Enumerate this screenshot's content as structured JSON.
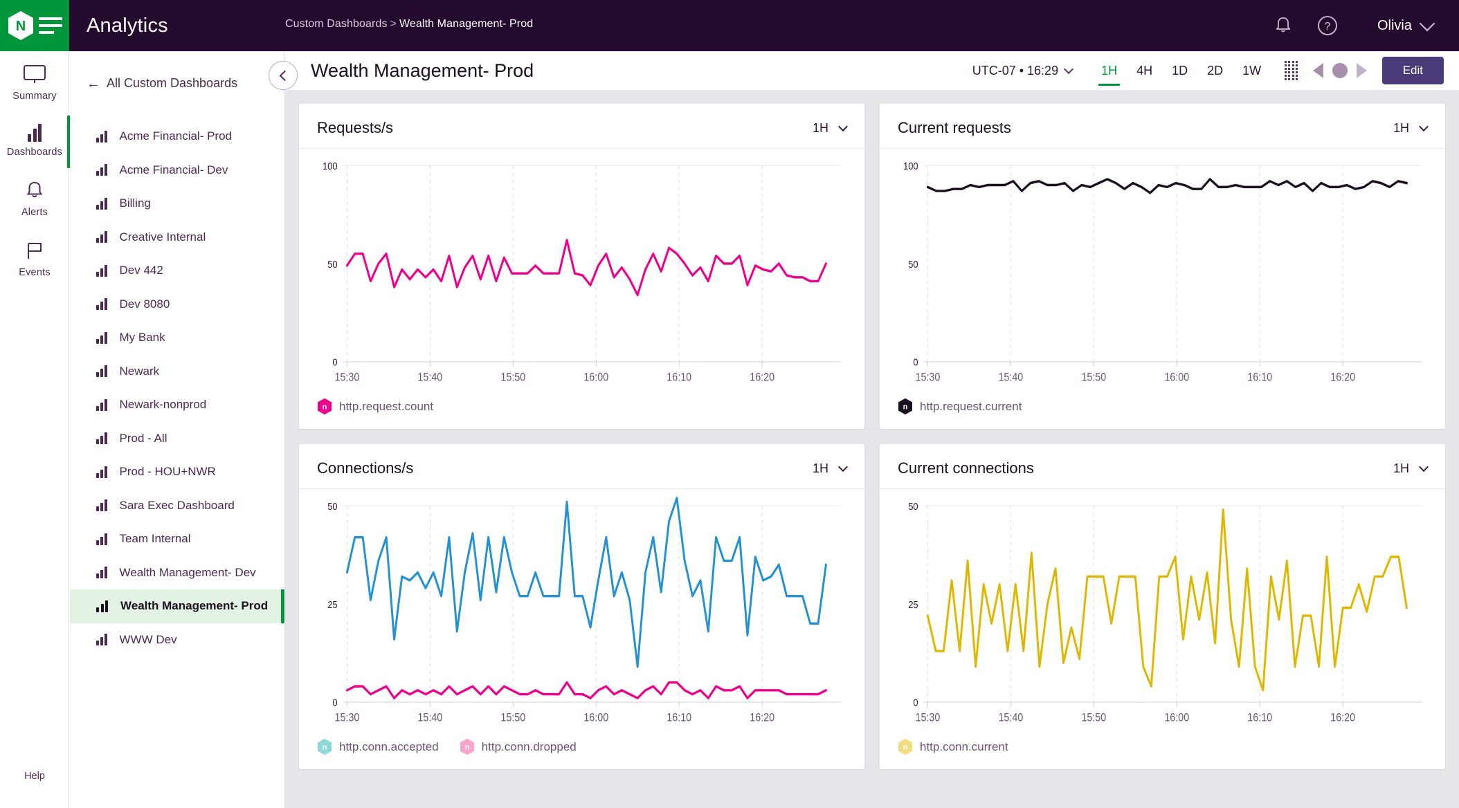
{
  "header": {
    "logo_icon": "nginx-logo-icon",
    "menu_icon": "hamburger-icon",
    "app_title": "Analytics",
    "breadcrumb_parent": "Custom Dashboards",
    "breadcrumb_separator": ">",
    "breadcrumb_current": "Wealth Management- Prod",
    "bell_icon": "notification-bell-icon",
    "help_icon": "help-circle-icon",
    "user_name": "Olivia",
    "bg_color": "#240a2e",
    "logo_bg_color": "#009639"
  },
  "rail": {
    "items": [
      {
        "label": "Summary",
        "icon": "monitor-icon",
        "active": false
      },
      {
        "label": "Dashboards",
        "icon": "bar-chart-icon",
        "active": true
      },
      {
        "label": "Alerts",
        "icon": "bell-icon",
        "active": false
      },
      {
        "label": "Events",
        "icon": "flag-icon",
        "active": false
      }
    ],
    "help_label": "Help",
    "active_color": "#009639"
  },
  "list_pane": {
    "back_label": "All Custom Dashboards",
    "back_icon": "arrow-left-icon",
    "items": [
      {
        "label": "Acme Financial- Prod",
        "active": false
      },
      {
        "label": "Acme Financial- Dev",
        "active": false
      },
      {
        "label": "Billing",
        "active": false
      },
      {
        "label": "Creative Internal",
        "active": false
      },
      {
        "label": "Dev 442",
        "active": false
      },
      {
        "label": "Dev 8080",
        "active": false
      },
      {
        "label": "My Bank",
        "active": false
      },
      {
        "label": "Newark",
        "active": false
      },
      {
        "label": "Newark-nonprod",
        "active": false
      },
      {
        "label": "Prod - All",
        "active": false
      },
      {
        "label": "Prod - HOU+NWR",
        "active": false
      },
      {
        "label": "Sara Exec Dashboard",
        "active": false
      },
      {
        "label": "Team Internal",
        "active": false
      },
      {
        "label": "Wealth Management- Dev",
        "active": false
      },
      {
        "label": "Wealth Management- Prod",
        "active": true
      },
      {
        "label": "WWW Dev",
        "active": false
      }
    ],
    "active_bg": "#e2f3e4"
  },
  "dashboard": {
    "collapse_icon": "chevron-left-circle-icon",
    "title": "Wealth Management- Prod",
    "timezone_label": "UTC-07 • 16:29",
    "timezone_chevron_icon": "chevron-down-icon",
    "ranges": [
      {
        "label": "1H",
        "active": true
      },
      {
        "label": "4H",
        "active": false
      },
      {
        "label": "1D",
        "active": false
      },
      {
        "label": "2D",
        "active": false
      },
      {
        "label": "1W",
        "active": false
      }
    ],
    "grid_icon": "grid-dots-icon",
    "prev_icon": "play-back-icon",
    "pause_icon": "pause-dot-icon",
    "next_icon": "play-forward-icon",
    "edit_label": "Edit",
    "edit_color": "#4a3a7a",
    "active_range_color": "#009639"
  },
  "chart_data": [
    {
      "type": "line",
      "title": "Requests/s",
      "range_label": "1H",
      "range_chevron_icon": "chevron-down-icon",
      "xlabel": "",
      "ylabel": "",
      "ylim": [
        0,
        100
      ],
      "yticks": [
        0,
        50,
        100
      ],
      "xticks": [
        "15:30",
        "15:40",
        "15:50",
        "16:00",
        "16:10",
        "16:20"
      ],
      "grid": "vertical-dotted",
      "legend_position": "bottom-left",
      "series": [
        {
          "name": "http.request.count",
          "color": "#ec008c",
          "legend_icon": "nginx-hex-icon",
          "values": [
            49,
            55,
            55,
            41,
            50,
            55,
            38,
            47,
            42,
            47,
            43,
            47,
            41,
            54,
            38,
            48,
            54,
            42,
            54,
            41,
            53,
            45,
            45,
            45,
            49,
            45,
            45,
            45,
            62,
            45,
            44,
            39,
            49,
            55,
            43,
            48,
            42,
            34,
            47,
            55,
            46,
            58,
            55,
            50,
            44,
            48,
            41,
            54,
            50,
            50,
            54,
            39,
            49,
            47,
            46,
            50,
            44,
            43,
            43,
            41,
            41,
            50
          ]
        }
      ]
    },
    {
      "type": "line",
      "title": "Current requests",
      "range_label": "1H",
      "range_chevron_icon": "chevron-down-icon",
      "xlabel": "",
      "ylabel": "",
      "ylim": [
        0,
        100
      ],
      "yticks": [
        0,
        50,
        100
      ],
      "xticks": [
        "15:30",
        "15:40",
        "15:50",
        "16:00",
        "16:10",
        "16:20"
      ],
      "grid": "vertical-dotted",
      "legend_position": "bottom-left",
      "series": [
        {
          "name": "http.request.current",
          "color": "#1c1020",
          "legend_icon": "nginx-hex-icon",
          "values": [
            89,
            87,
            87,
            88,
            88,
            90,
            89,
            90,
            90,
            90,
            92,
            87,
            91,
            92,
            90,
            90,
            91,
            87,
            90,
            89,
            91,
            93,
            91,
            88,
            91,
            89,
            86,
            90,
            89,
            91,
            90,
            88,
            88,
            93,
            89,
            89,
            90,
            89,
            89,
            89,
            92,
            90,
            92,
            89,
            91,
            87,
            91,
            89,
            89,
            90,
            88,
            89,
            92,
            91,
            89,
            92,
            91
          ]
        }
      ]
    },
    {
      "type": "line",
      "title": "Connections/s",
      "range_label": "1H",
      "range_chevron_icon": "chevron-down-icon",
      "xlabel": "",
      "ylabel": "",
      "ylim": [
        0,
        50
      ],
      "yticks": [
        0,
        25,
        50
      ],
      "xticks": [
        "15:30",
        "15:40",
        "15:50",
        "16:00",
        "16:10",
        "16:20"
      ],
      "grid": "vertical-dotted",
      "legend_position": "bottom-left",
      "series": [
        {
          "name": "http.conn.accepted",
          "color": "#2591d0",
          "legend_icon": "nginx-hex-icon",
          "legend_color": "#8ed8d8",
          "values": [
            33,
            42,
            42,
            26,
            36,
            42,
            16,
            32,
            31,
            33,
            29,
            33,
            27,
            42,
            18,
            33,
            43,
            26,
            42,
            28,
            42,
            33,
            27,
            27,
            33,
            27,
            27,
            27,
            51,
            27,
            27,
            19,
            31,
            42,
            27,
            33,
            26,
            9,
            33,
            42,
            28,
            46,
            52,
            36,
            27,
            31,
            18,
            42,
            36,
            36,
            42,
            17,
            37,
            31,
            32,
            35,
            27,
            27,
            27,
            20,
            20,
            35
          ]
        },
        {
          "name": "http.conn.dropped",
          "color": "#ec008c",
          "legend_icon": "nginx-hex-icon",
          "legend_color": "#f9a3cd",
          "values": [
            3,
            4,
            4,
            2,
            3,
            4,
            1,
            3,
            2,
            3,
            2,
            3,
            2,
            4,
            2,
            3,
            4,
            2,
            4,
            2,
            4,
            3,
            2,
            2,
            3,
            2,
            2,
            2,
            5,
            2,
            2,
            1,
            3,
            4,
            2,
            3,
            2,
            1,
            3,
            4,
            2,
            5,
            5,
            3,
            2,
            3,
            1,
            4,
            3,
            3,
            4,
            1,
            3,
            3,
            3,
            3,
            2,
            2,
            2,
            2,
            2,
            3
          ]
        }
      ]
    },
    {
      "type": "line",
      "title": "Current connections",
      "range_label": "1H",
      "range_chevron_icon": "chevron-down-icon",
      "xlabel": "",
      "ylabel": "",
      "ylim": [
        0,
        50
      ],
      "yticks": [
        0,
        25,
        50
      ],
      "xticks": [
        "15:30",
        "15:40",
        "15:50",
        "16:00",
        "16:10",
        "16:20"
      ],
      "grid": "vertical-dotted",
      "legend_position": "bottom-left",
      "series": [
        {
          "name": "http.conn.current",
          "color": "#e0b700",
          "legend_icon": "nginx-hex-icon",
          "legend_color": "#f0dd80",
          "values": [
            22,
            13,
            13,
            31,
            13,
            36,
            9,
            30,
            20,
            30,
            13,
            30,
            13,
            38,
            9,
            25,
            34,
            10,
            19,
            11,
            32,
            32,
            32,
            20,
            32,
            32,
            32,
            9,
            4,
            32,
            32,
            37,
            16,
            32,
            21,
            33,
            15,
            49,
            21,
            9,
            34,
            9,
            3,
            32,
            21,
            36,
            9,
            22,
            22,
            9,
            37,
            9,
            24,
            24,
            30,
            23,
            32,
            32,
            37,
            37,
            24
          ]
        }
      ]
    }
  ]
}
